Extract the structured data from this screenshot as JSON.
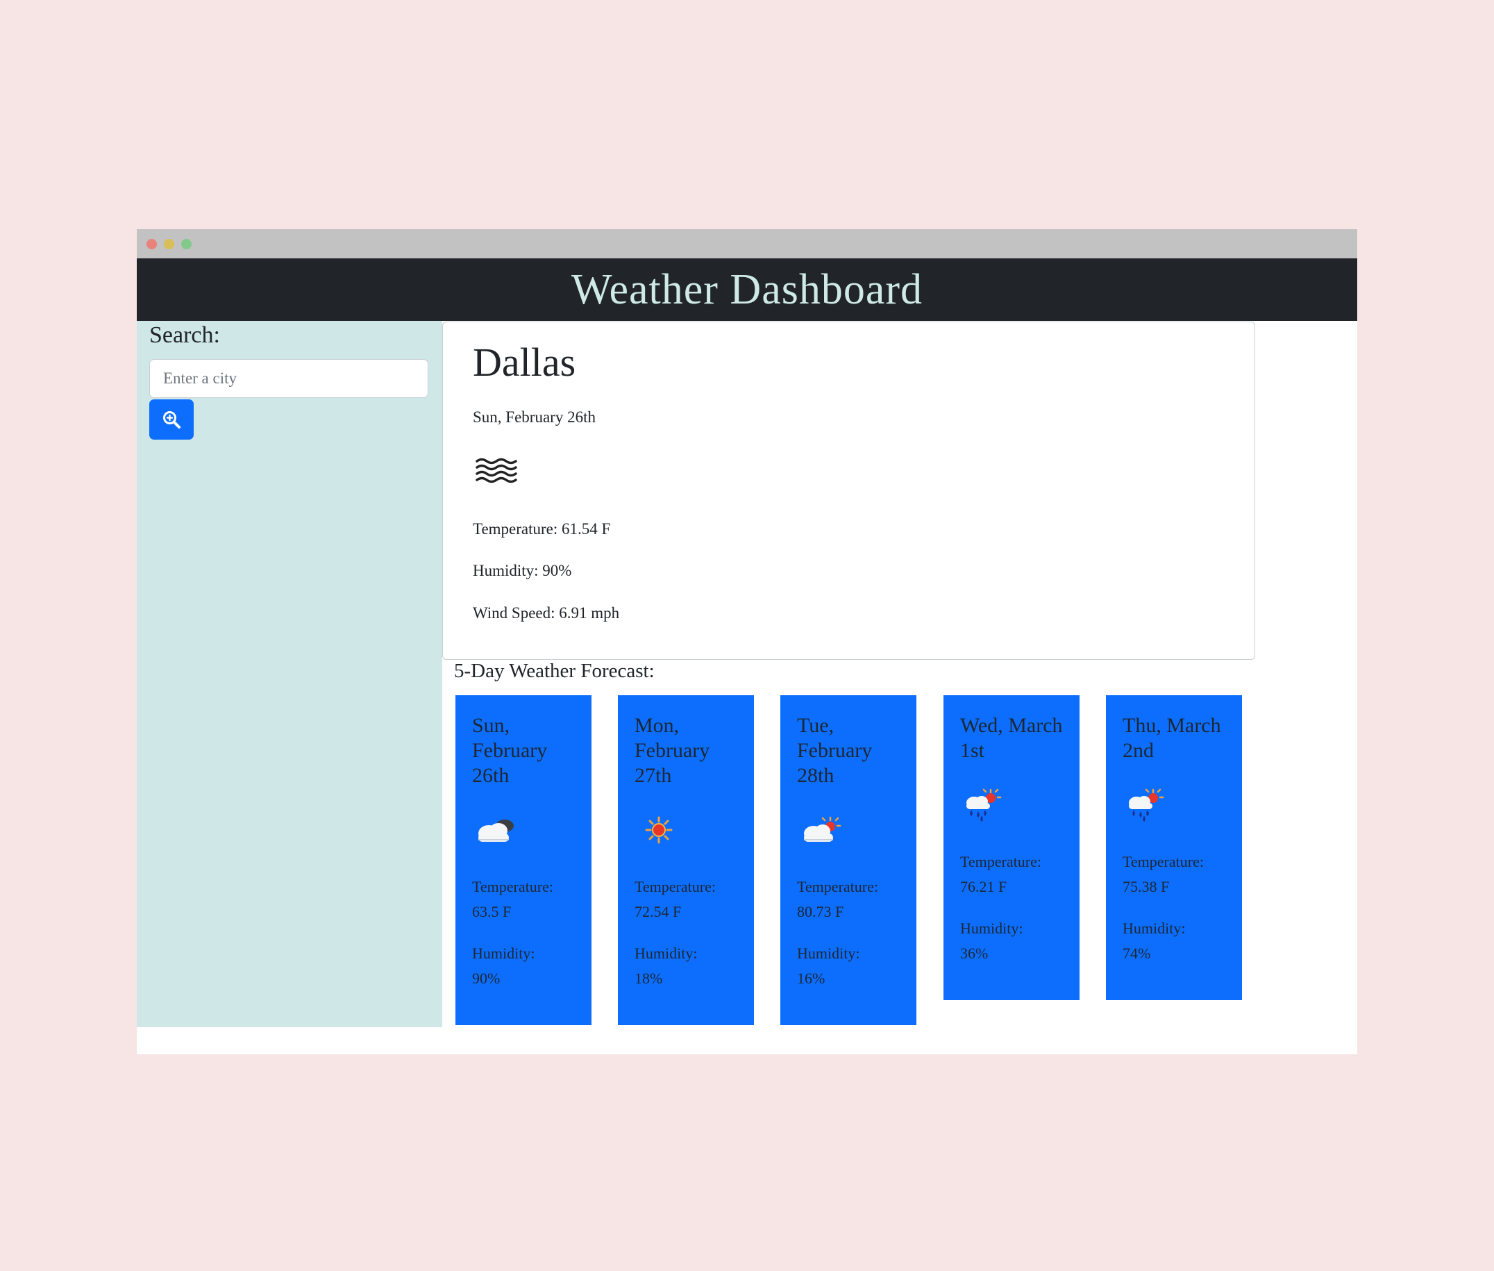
{
  "app": {
    "title": "Weather Dashboard"
  },
  "search": {
    "label": "Search:",
    "placeholder": "Enter a city",
    "value": "",
    "button_icon": "search-zoom-icon"
  },
  "current": {
    "city": "Dallas",
    "date": "Sun, February 26th",
    "icon": "mist-icon",
    "temperature": "Temperature: 61.54 F",
    "humidity": "Humidity: 90%",
    "wind": "Wind Speed: 6.91 mph"
  },
  "forecast": {
    "title": "5-Day Weather Forecast:",
    "temperature_label": "Temperature:",
    "humidity_label": "Humidity:",
    "days": [
      {
        "date": "Sun, February 26th",
        "icon": "cloudy-night-icon",
        "temperature": "63.5 F",
        "humidity": "90%"
      },
      {
        "date": "Mon, February 27th",
        "icon": "sun-icon",
        "temperature": "72.54 F",
        "humidity": "18%"
      },
      {
        "date": "Tue, February 28th",
        "icon": "partly-cloudy-icon",
        "temperature": "80.73 F",
        "humidity": "16%"
      },
      {
        "date": "Wed, March 1st",
        "icon": "sun-rain-icon",
        "temperature": "76.21 F",
        "humidity": "36%"
      },
      {
        "date": "Thu, March 2nd",
        "icon": "sun-rain-icon",
        "temperature": "75.38 F",
        "humidity": "74%"
      }
    ]
  },
  "colors": {
    "header_bg": "#212529",
    "header_text": "#cfe9e7",
    "sidebar_bg": "#cfe8e7",
    "accent": "#0d6efd",
    "page_bg": "#f7e5e5"
  }
}
